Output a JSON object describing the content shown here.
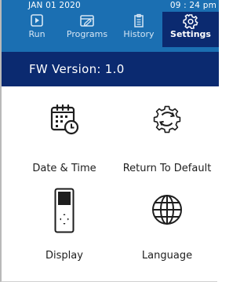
{
  "status": {
    "date": "JAN 01 2020",
    "time": "09 : 24 pm"
  },
  "tabs": [
    {
      "label": "Run",
      "icon": "play-icon",
      "active": false
    },
    {
      "label": "Programs",
      "icon": "programs-icon",
      "active": false
    },
    {
      "label": "History",
      "icon": "history-icon",
      "active": false
    },
    {
      "label": "Settings",
      "icon": "gear-icon",
      "active": true
    }
  ],
  "header": {
    "fw_version": "FW Version: 1.0"
  },
  "settings": [
    {
      "label": "Date & Time",
      "icon": "calendar-clock-icon"
    },
    {
      "label": "Return To Default",
      "icon": "reset-gear-icon"
    },
    {
      "label": "Display",
      "icon": "display-device-icon"
    },
    {
      "label": "Language",
      "icon": "globe-icon"
    }
  ],
  "colors": {
    "brand_blue": "#1b6fb2",
    "dark_navy": "#0b2a70",
    "text": "#1e1e1e"
  }
}
